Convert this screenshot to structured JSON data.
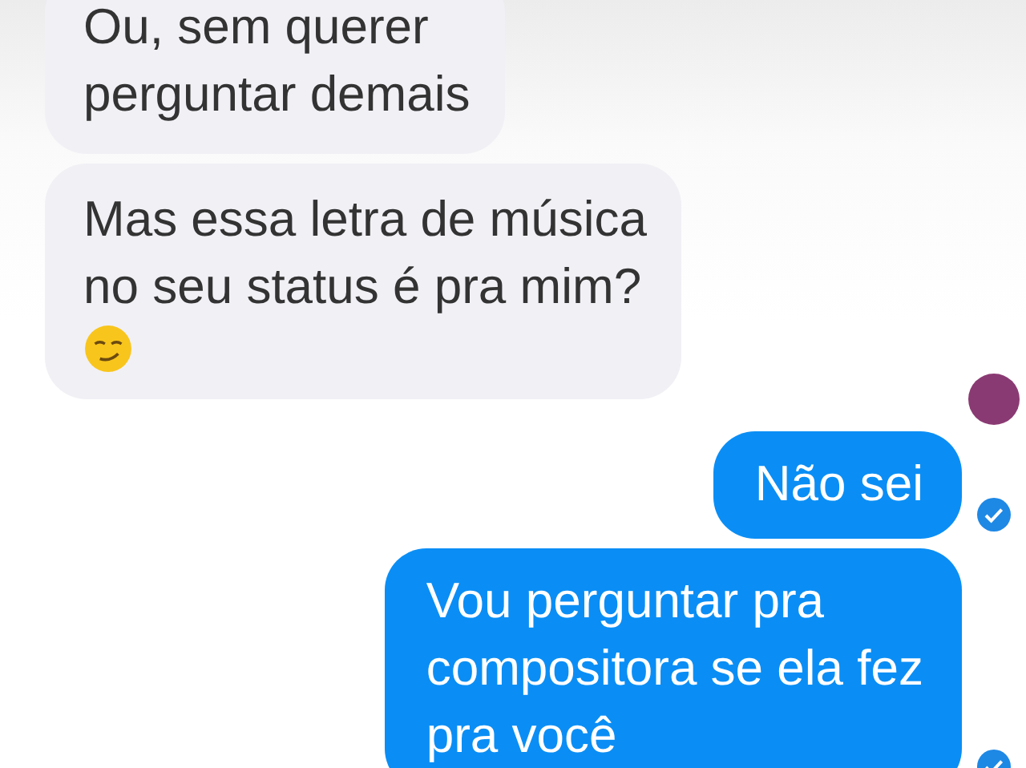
{
  "messages": [
    {
      "kind": "incoming",
      "lines": [
        "Ou, sem querer",
        "perguntar demais"
      ]
    },
    {
      "kind": "incoming",
      "lines": [
        "Mas essa letra de música",
        "no seu status é pra mim?"
      ],
      "emoji": true,
      "avatar": true
    },
    {
      "kind": "outgoing",
      "lines": [
        "Não sei"
      ],
      "read": true
    },
    {
      "kind": "outgoing",
      "lines": [
        "Vou perguntar pra",
        "compositora se ela fez",
        "pra você"
      ],
      "read": true
    }
  ]
}
